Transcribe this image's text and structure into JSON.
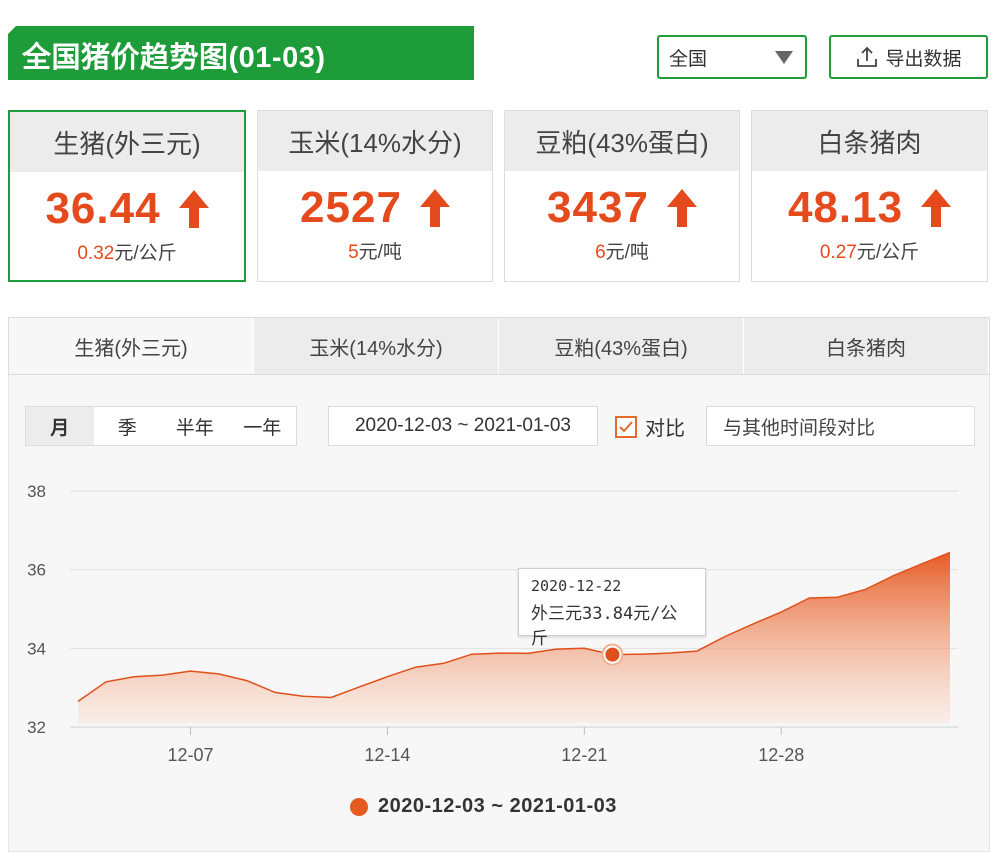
{
  "header": {
    "title": "全国猪价趋势图(01-03)",
    "region_select": "全国",
    "export_label": "导出数据"
  },
  "cards": [
    {
      "name": "生猪(外三元)",
      "value": "36.44",
      "change": "0.32",
      "unit": "元/公斤",
      "trend": "up"
    },
    {
      "name": "玉米(14%水分)",
      "value": "2527",
      "change": "5",
      "unit": "元/吨",
      "trend": "up"
    },
    {
      "name": "豆粕(43%蛋白)",
      "value": "3437",
      "change": "6",
      "unit": "元/吨",
      "trend": "up"
    },
    {
      "name": "白条猪肉",
      "value": "48.13",
      "change": "0.27",
      "unit": "元/公斤",
      "trend": "up"
    }
  ],
  "tabs": [
    "生猪(外三元)",
    "玉米(14%水分)",
    "豆粕(43%蛋白)",
    "白条猪肉"
  ],
  "controls": {
    "periods": [
      "月",
      "季",
      "半年",
      "一年"
    ],
    "date_range": "2020-12-03 ~ 2021-01-03",
    "compare_label": "对比",
    "compare_placeholder": "与其他时间段对比"
  },
  "tooltip": {
    "date": "2020-12-22",
    "text": "外三元33.84元/公斤"
  },
  "colors": {
    "brand_green": "#1f9c3a",
    "accent_orange": "#e54a1c",
    "series_orange": "#e55a1f"
  },
  "chart_data": {
    "type": "area",
    "x": [
      "2020-12-03",
      "2020-12-04",
      "2020-12-05",
      "2020-12-06",
      "2020-12-07",
      "2020-12-08",
      "2020-12-09",
      "2020-12-10",
      "2020-12-11",
      "2020-12-12",
      "2020-12-13",
      "2020-12-14",
      "2020-12-15",
      "2020-12-16",
      "2020-12-17",
      "2020-12-18",
      "2020-12-19",
      "2020-12-20",
      "2020-12-21",
      "2020-12-22",
      "2020-12-23",
      "2020-12-24",
      "2020-12-25",
      "2020-12-26",
      "2020-12-27",
      "2020-12-28",
      "2020-12-29",
      "2020-12-30",
      "2020-12-31",
      "2021-01-01",
      "2021-01-02",
      "2021-01-03"
    ],
    "series": [
      {
        "name": "2020-12-03 ~ 2021-01-03",
        "values": [
          32.65,
          33.15,
          33.28,
          33.32,
          33.42,
          33.35,
          33.18,
          32.88,
          32.78,
          32.75,
          33.02,
          33.28,
          33.52,
          33.62,
          33.85,
          33.88,
          33.87,
          33.98,
          34.0,
          33.84,
          33.85,
          33.88,
          33.93,
          34.3,
          34.62,
          34.92,
          35.28,
          35.3,
          35.5,
          35.85,
          36.15,
          36.44
        ]
      }
    ],
    "ylim": [
      32,
      38
    ],
    "yticks": [
      32,
      34,
      36,
      38
    ],
    "xticks": [
      "12-07",
      "12-14",
      "12-21",
      "12-28"
    ],
    "xtick_dates": [
      "2020-12-07",
      "2020-12-14",
      "2020-12-21",
      "2020-12-28"
    ],
    "highlight_date": "2020-12-22",
    "grid": true,
    "legend": "bottom-center"
  }
}
